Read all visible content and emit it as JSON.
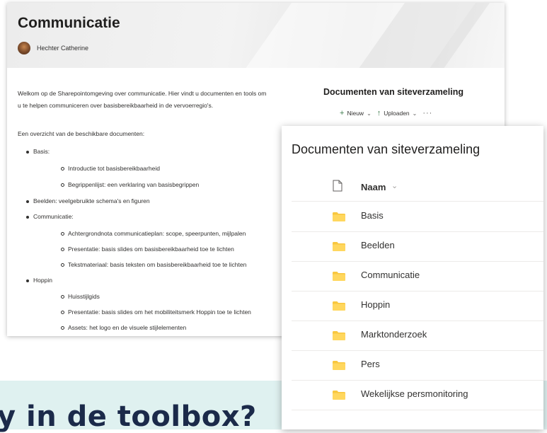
{
  "banner": {
    "text": "y in de toolbox?"
  },
  "page": {
    "title": "Communicatie",
    "author": "Hechter Catherine",
    "intro_line1": "Welkom op de Sharepointomgeving over communicatie. Hier vindt u documenten en tools om",
    "intro_line2": "u te helpen communiceren over basisbereikbaarheid in de vervoerregio's.",
    "overview": "Een overzicht van de beschikbare documenten:",
    "list": [
      {
        "label": "Basis:",
        "children": [
          "Introductie tot basisbereikbaarheid",
          "Begrippenlijst: een verklaring van basisbegrippen"
        ]
      },
      {
        "label": "Beelden: veelgebruikte schema's en figuren",
        "children": []
      },
      {
        "label": "Communicatie:",
        "children": [
          "Achtergrondnota communicatieplan: scope, speerpunten, mijlpalen",
          "Presentatie: basis slides om basisbereikbaarheid toe te lichten",
          "Tekstmateriaal: basis teksten om basisbereikbaarheid toe te lichten"
        ]
      },
      {
        "label": "Hoppin",
        "children": [
          "Huisstijlgids",
          "Presentatie: basis slides om het mobiliteitsmerk Hoppin toe te lichten",
          "Assets: het logo en de visuele stijlelementen"
        ]
      }
    ],
    "side_title": "Documenten van siteverzameling",
    "cmd_new": "Nieuw",
    "cmd_upload": "Uploaden",
    "cmd_more": "···"
  },
  "library": {
    "title": "Documenten van siteverzameling",
    "column_name": "Naam",
    "folders": [
      "Basis",
      "Beelden",
      "Communicatie",
      "Hoppin",
      "Marktonderzoek",
      "Pers",
      "Wekelijkse persmonitoring"
    ]
  },
  "colors": {
    "banner": "#dff1f0",
    "folder": "#f8c73f",
    "accent_green": "#3c7a4b"
  },
  "icons": {
    "avatar": "person-photo",
    "new": "plus-icon",
    "upload": "upload-arrow-icon",
    "file": "document-icon",
    "folder": "folder-icon"
  }
}
